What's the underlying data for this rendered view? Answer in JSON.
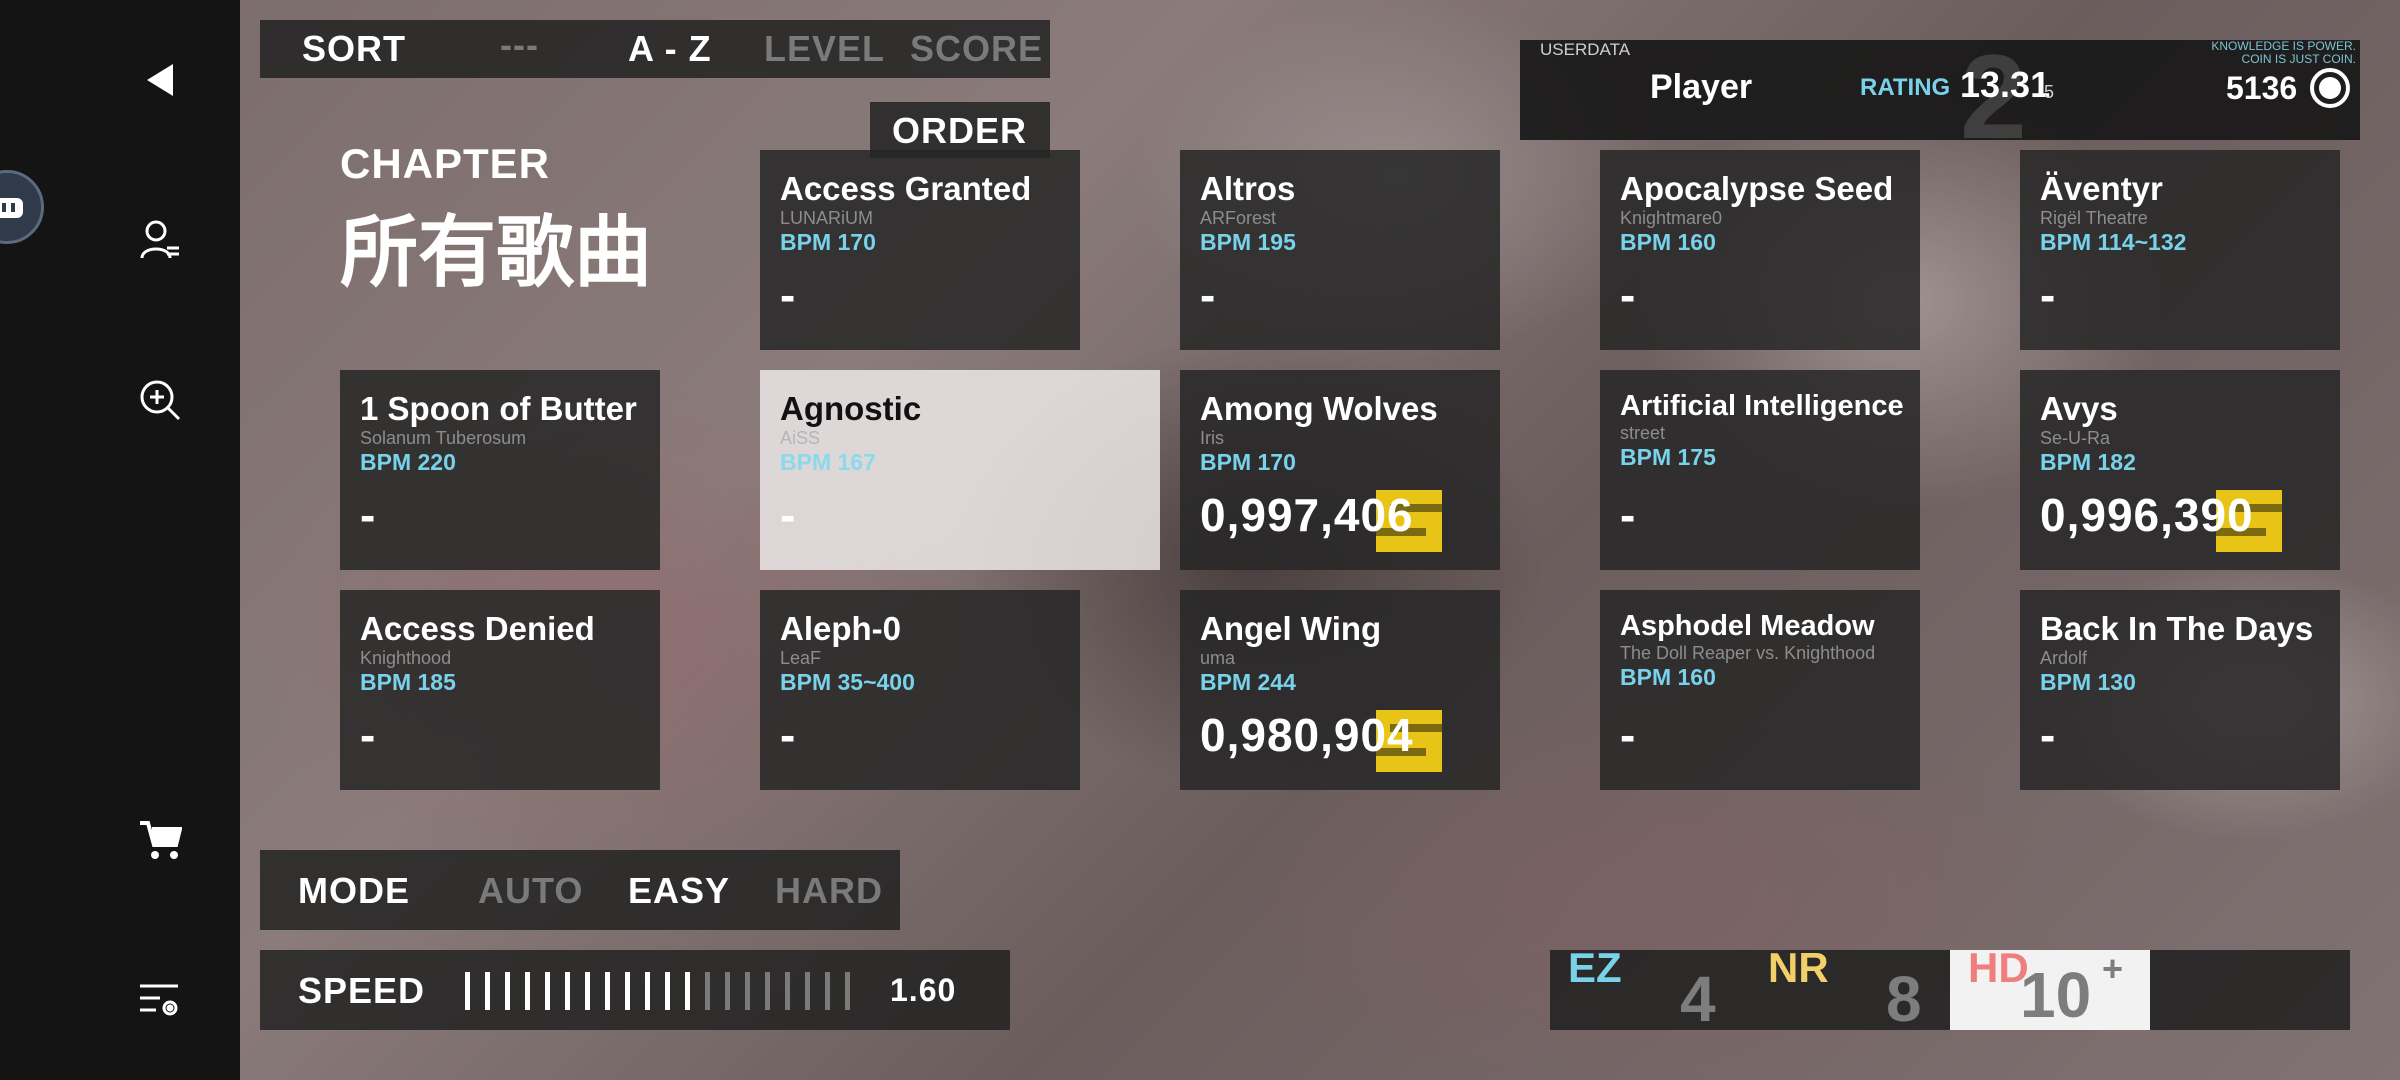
{
  "sort": {
    "label": "SORT",
    "options": [
      "---",
      "A - Z",
      "LEVEL",
      "SCORE"
    ],
    "active": "A - Z",
    "order_label": "ORDER"
  },
  "chapter": {
    "label": "CHAPTER",
    "title": "所有歌曲"
  },
  "userdata": {
    "label": "USERDATA",
    "player_name": "Player",
    "rating_label": "RATING",
    "rating": "13.31",
    "rating_sub": "5",
    "watermark_number": "2",
    "motto_line1": "KNOWLEDGE IS POWER.",
    "motto_line2": "COIN IS JUST COIN.",
    "coins": "5136"
  },
  "songs": [
    {
      "title": "Access Granted",
      "artist": "LUNARiUM",
      "bpm": "BPM 170",
      "score": "-"
    },
    {
      "title": "Altros",
      "artist": "ARForest",
      "bpm": "BPM 195",
      "score": "-"
    },
    {
      "title": "Apocalypse Seed",
      "artist": "Knightmare0",
      "bpm": "BPM 160",
      "score": "-"
    },
    {
      "title": "Äventyr",
      "artist": "Rigël Theatre",
      "bpm": "BPM 114~132",
      "score": "-"
    },
    {
      "title": "1 Spoon of Butter",
      "artist": "Solanum Tuberosum",
      "bpm": "BPM 220",
      "score": "-"
    },
    {
      "title": "Agnostic",
      "artist": "AiSS",
      "bpm": "BPM 167",
      "score": "-"
    },
    {
      "title": "Among Wolves",
      "artist": "Iris",
      "bpm": "BPM 170",
      "score": "0,997,406",
      "rank": "S"
    },
    {
      "title": "Artificial Intelligence",
      "artist": "street",
      "bpm": "BPM 175",
      "score": "-"
    },
    {
      "title": "Avys",
      "artist": "Se-U-Ra",
      "bpm": "BPM 182",
      "score": "0,996,390",
      "rank": "S"
    },
    {
      "title": "Access Denied",
      "artist": "Knighthood",
      "bpm": "BPM 185",
      "score": "-"
    },
    {
      "title": "Aleph-0",
      "artist": "LeaF",
      "bpm": "BPM 35~400",
      "score": "-"
    },
    {
      "title": "Angel Wing",
      "artist": "uma",
      "bpm": "BPM 244",
      "score": "0,980,904",
      "rank": "S"
    },
    {
      "title": "Asphodel Meadow",
      "artist": "The Doll Reaper vs. Knighthood",
      "bpm": "BPM 160",
      "score": "-"
    },
    {
      "title": "Back In The Days",
      "artist": "Ardolf",
      "bpm": "BPM 130",
      "score": "-"
    }
  ],
  "mode": {
    "label": "MODE",
    "options": [
      "AUTO",
      "EASY",
      "HARD"
    ],
    "active": "EASY"
  },
  "speed": {
    "label": "SPEED",
    "value": "1.60",
    "level_fraction": 0.6
  },
  "difficulty": {
    "ez_label": "EZ",
    "ez_level": "4",
    "nr_label": "NR",
    "nr_level": "8",
    "hd_label": "HD",
    "hd_level": "10",
    "hd_plus": "+",
    "colors": {
      "ez": "#78d2ea",
      "nr": "#f1d06a",
      "hd": "#ef7f7f"
    }
  },
  "icons": [
    "back-arrow-icon",
    "user-settings-icon",
    "search-zoom-icon",
    "cart-icon",
    "list-settings-icon",
    "chat-bubble-icon",
    "coin-icon"
  ]
}
